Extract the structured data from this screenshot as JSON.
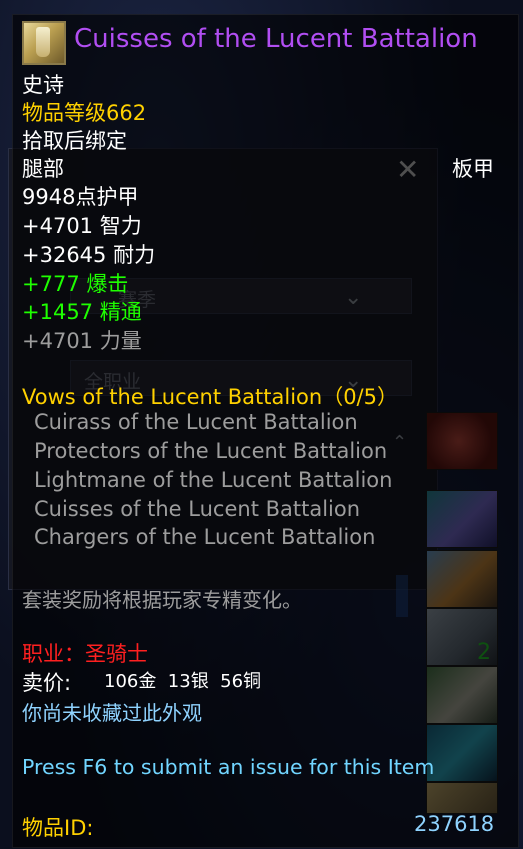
{
  "background": {
    "dropdown_season": "赛季",
    "dropdown_class": "全职业"
  },
  "item": {
    "name": "Cuisses of the Lucent Battalion",
    "quality": "史诗",
    "item_level": "物品等级662",
    "binding": "拾取后绑定",
    "slot": "腿部",
    "armor_type": "板甲",
    "armor": "9948点护甲",
    "stats": {
      "intellect": "+4701 智力",
      "stamina": "+32645 耐力",
      "crit": "+777 爆击",
      "mastery": "+1457 精通",
      "strength": "+4701 力量"
    },
    "set": {
      "title": "Vows of the Lucent Battalion（0/5）",
      "pieces": [
        "Cuirass of the Lucent Battalion",
        "Protectors of the Lucent Battalion",
        "Lightmane of the Lucent Battalion",
        "Cuisses of the Lucent Battalion",
        "Chargers of the Lucent Battalion"
      ],
      "bonus_note": "套装奖励将根据玩家专精变化。"
    },
    "class_label": "职业：圣骑士",
    "sell_price_label": "卖价:",
    "sell_price_value": "106金  13银  56铜",
    "transmog_status": "你尚未收藏过此外观",
    "issue_prompt": "Press F6 to submit an issue for this Item",
    "id_label": "物品ID:",
    "id_value": "237618"
  },
  "icon_column": {
    "stack_count": "2"
  }
}
